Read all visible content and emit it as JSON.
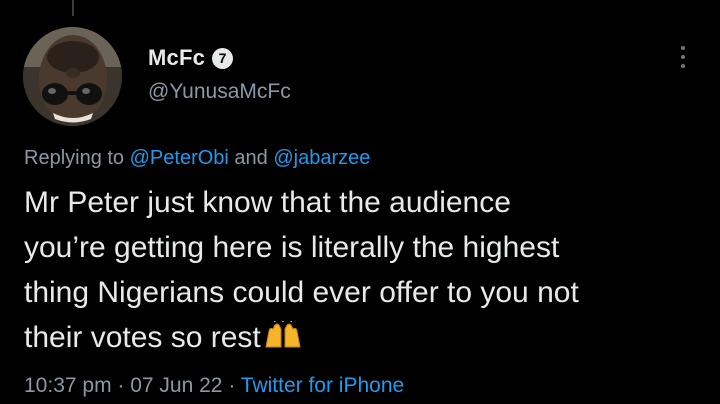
{
  "user": {
    "display_name": "McFc",
    "badge": "7",
    "handle": "@YunusaMcFc"
  },
  "reply": {
    "prefix": "Replying to ",
    "mention_1": "@PeterObi",
    "conjunction": " and ",
    "mention_2": "@jabarzee"
  },
  "tweet": {
    "text": "Mr Peter just know that the audience\nyou’re getting here is literally the highest\nthing Nigerians could ever offer to you not\ntheir votes so rest",
    "emoji": "raising-hands-emoji"
  },
  "meta": {
    "time": "10:37 pm",
    "separator_1": " · ",
    "date": "07 Jun 22",
    "separator_2": " · ",
    "source": "Twitter for iPhone"
  },
  "icons": {
    "more": "more-vertical-icon"
  },
  "colors": {
    "background": "#000000",
    "text": "#e7e9ea",
    "secondary": "#8b98a5",
    "link": "#1d9bf0"
  }
}
